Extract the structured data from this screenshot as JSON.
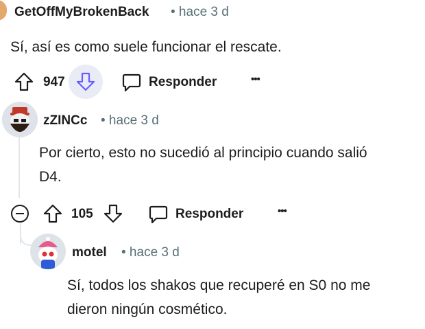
{
  "comments": [
    {
      "author": "GetOffMyBrokenBack",
      "time": "• hace 3 d",
      "body": "Sí, así es como suele funcionar el rescate.",
      "votes": "947",
      "reply_label": "Responder",
      "more": "•••",
      "downvoted": true
    },
    {
      "author": "zZINCc",
      "time": "• hace 3 d",
      "body_lines": [
        "Por cierto, esto no sucedió al principio cuando salió",
        "D4."
      ],
      "votes": "105",
      "reply_label": "Responder",
      "more": "•••",
      "collapse_icon": "minus-circle-icon"
    },
    {
      "author": "motel",
      "time": "• hace 3 d",
      "body_lines": [
        "Sí, todos los shakos que recuperé en S0 no me",
        "dieron ningún cosmético."
      ]
    }
  ],
  "colors": {
    "accent_downvote": "#6a5cff",
    "downvote_bg": "#e9ecf5",
    "meta": "#576f76"
  }
}
